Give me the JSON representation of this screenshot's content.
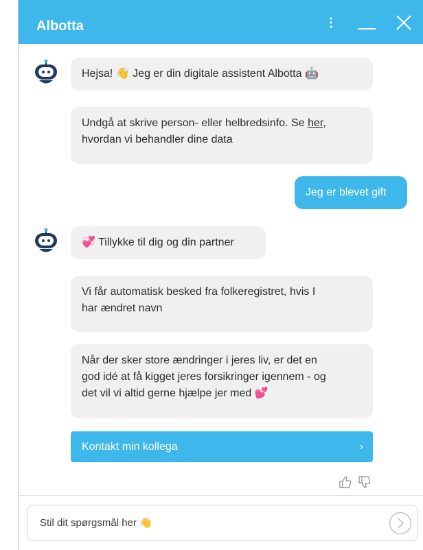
{
  "header": {
    "title": "Albotta",
    "menu_icon": "kebab-menu-icon",
    "minimize_icon": "minimize-icon",
    "close_icon": "close-icon",
    "color": "#3eb7ea"
  },
  "messages": {
    "bot1": "Hejsa! 👋 Jeg er din digitale assistent Albotta 🤖",
    "bot2_line1_pre": "Undgå at skrive person- eller helbredsinfo. Se ",
    "bot2_link": "her",
    "bot2_line1_post": ",",
    "bot2_line2": "hvordan vi behandler dine data",
    "user1": "Jeg er blevet gift",
    "bot3": "💞 Tillykke til dig og din partner",
    "bot4_line1": "Vi får automatisk besked fra folkeregistret, hvis I",
    "bot4_line2": "har ændret navn",
    "bot5_line1": "Når der sker store ændringer i jeres liv, er det en",
    "bot5_line2": "god idé at få kigget jeres forsikringer igennem - og",
    "bot5_line3": "det vil vi altid gerne hjælpe jer med 💕"
  },
  "cta": {
    "label": "Kontakt min kollega",
    "chevron": "›"
  },
  "feedback": {
    "up_icon": "thumbs-up-icon",
    "down_icon": "thumbs-down-icon"
  },
  "composer": {
    "placeholder": "Stil dit spørgsmål her 👋",
    "send_icon": "send-arrow-icon"
  }
}
